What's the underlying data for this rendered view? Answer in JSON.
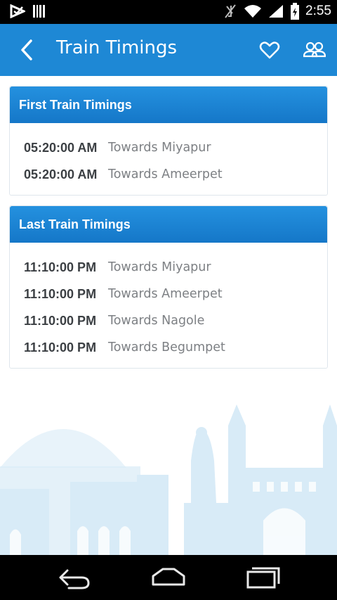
{
  "status_bar": {
    "time": "2:55"
  },
  "app_bar": {
    "title": "Train Timings"
  },
  "first_train": {
    "title": "First Train Timings",
    "rows": [
      {
        "time": "05:20:00 AM",
        "destination": "Towards Miyapur"
      },
      {
        "time": "05:20:00 AM",
        "destination": "Towards Ameerpet"
      }
    ]
  },
  "last_train": {
    "title": "Last Train Timings",
    "rows": [
      {
        "time": "11:10:00 PM",
        "destination": "Towards Miyapur"
      },
      {
        "time": "11:10:00 PM",
        "destination": "Towards Ameerpet"
      },
      {
        "time": "11:10:00 PM",
        "destination": "Towards Nagole"
      },
      {
        "time": "11:10:00 PM",
        "destination": "Towards Begumpet"
      }
    ]
  },
  "colors": {
    "primary": "#1e88d5",
    "header_gradient_top": "#2491df",
    "header_gradient_bottom": "#1577c8",
    "skyline": "#d8ebf7"
  },
  "icons": [
    "back-arrow-icon",
    "heart-icon",
    "group-icon",
    "notification-icon",
    "barcode-icon",
    "mute-icon",
    "wifi-icon",
    "signal-icon",
    "battery-icon",
    "nav-back-icon",
    "nav-home-icon",
    "nav-recents-icon"
  ]
}
